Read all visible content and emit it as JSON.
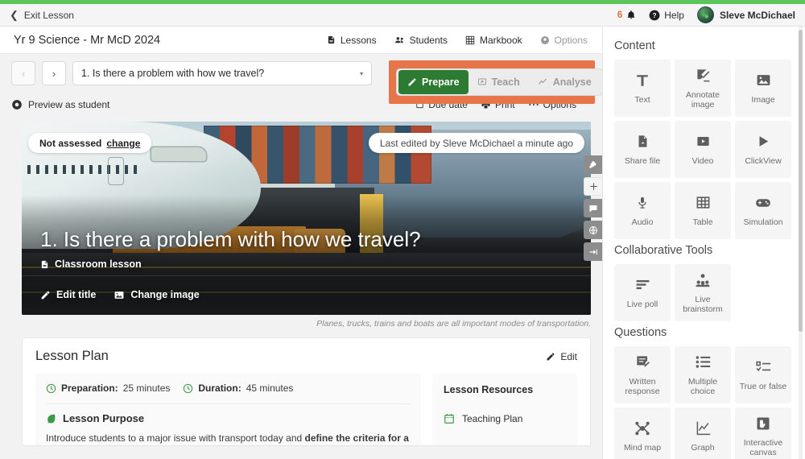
{
  "topbar": {
    "exit_label": "Exit Lesson",
    "notification_count": "6",
    "help_label": "Help",
    "user_name": "Sleve McDichael"
  },
  "class_header": {
    "title": "Yr 9 Science - Mr McD 2024",
    "nav": [
      {
        "label": "Lessons",
        "icon": "document-icon",
        "muted": false
      },
      {
        "label": "Students",
        "icon": "people-icon",
        "muted": false
      },
      {
        "label": "Markbook",
        "icon": "grid-icon",
        "muted": false
      },
      {
        "label": "Options",
        "icon": "gear-icon",
        "muted": true
      }
    ]
  },
  "lesson_nav": {
    "prev_label": "‹",
    "next_label": "›",
    "selected_lesson": "1. Is there a problem with how we travel?",
    "caret": "▾"
  },
  "modes": [
    {
      "label": "Prepare",
      "icon": "pencil-icon",
      "active": true
    },
    {
      "label": "Teach",
      "icon": "present-icon",
      "active": false
    },
    {
      "label": "Analyse",
      "icon": "chart-line-icon",
      "active": false
    }
  ],
  "toolrow": {
    "preview_label": "Preview as student",
    "due_date_label": "Due date",
    "print_label": "Print",
    "options_label": "Options"
  },
  "hero": {
    "assessment_status": "Not assessed",
    "assessment_change": "change",
    "last_edited": "Last edited by Sleve McDichael a minute ago",
    "title": "1. Is there a problem with how we travel?",
    "lesson_type": "Classroom lesson",
    "edit_title_label": "Edit title",
    "change_image_label": "Change image",
    "caption": "Planes, trucks, trains and boats are all important modes of transportation."
  },
  "lesson_plan": {
    "heading": "Lesson Plan",
    "edit_label": "Edit",
    "preparation_label": "Preparation:",
    "preparation_value": "25 minutes",
    "duration_label": "Duration:",
    "duration_value": "45 minutes",
    "purpose_heading": "Lesson Purpose",
    "purpose_text_a": "Introduce students to a major issue with transport today and ",
    "purpose_text_b": "define the criteria for a",
    "resources_title": "Lesson Resources",
    "resource_item": "Teaching Plan"
  },
  "rail": [
    {
      "name": "pin-icon",
      "style": "dark"
    },
    {
      "name": "plus-icon",
      "style": "light"
    },
    {
      "name": "comment-icon",
      "style": "dark"
    },
    {
      "name": "globe-icon",
      "style": "dark"
    },
    {
      "name": "collapse-right-icon",
      "style": "dark"
    }
  ],
  "panel": {
    "sections": [
      {
        "heading": "Content",
        "tiles": [
          {
            "label": "Text",
            "icon": "text-icon"
          },
          {
            "label": "Annotate image",
            "icon": "annotate-image-icon"
          },
          {
            "label": "Image",
            "icon": "image-icon"
          },
          {
            "label": "Share file",
            "icon": "share-file-icon"
          },
          {
            "label": "Video",
            "icon": "video-icon"
          },
          {
            "label": "ClickView",
            "icon": "play-icon"
          },
          {
            "label": "Audio",
            "icon": "microphone-icon"
          },
          {
            "label": "Table",
            "icon": "table-icon"
          },
          {
            "label": "Simulation",
            "icon": "gamepad-icon"
          }
        ]
      },
      {
        "heading": "Collaborative Tools",
        "tiles": [
          {
            "label": "Live poll",
            "icon": "poll-icon"
          },
          {
            "label": "Live brainstorm",
            "icon": "brainstorm-icon"
          }
        ]
      },
      {
        "heading": "Questions",
        "tiles": [
          {
            "label": "Written response",
            "icon": "written-response-icon"
          },
          {
            "label": "Multiple choice",
            "icon": "list-icon"
          },
          {
            "label": "True or false",
            "icon": "true-false-icon"
          },
          {
            "label": "Mind map",
            "icon": "mind-map-icon"
          },
          {
            "label": "Graph",
            "icon": "graph-icon"
          },
          {
            "label": "Interactive canvas",
            "icon": "interactive-canvas-icon"
          }
        ]
      }
    ]
  },
  "colors": {
    "brand_green": "#5cc65c",
    "active_green": "#2d7a33",
    "highlight_orange": "#e8754a",
    "notification_orange": "#e2703a"
  }
}
